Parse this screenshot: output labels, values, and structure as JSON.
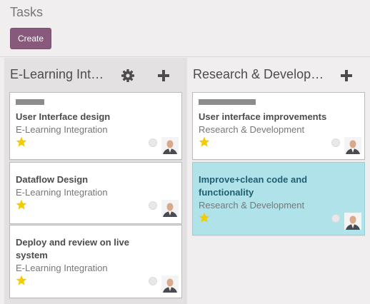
{
  "header": {
    "breadcrumb": "Tasks",
    "create_label": "Create"
  },
  "colors": {
    "primary": "#875a7b",
    "selected_card": "#b0e3e9",
    "star": "#f3cc00",
    "color_bar": "#8c8c8c"
  },
  "columns": [
    {
      "title": "E-Learning Integration",
      "icons": [
        "gear-icon",
        "plus-icon"
      ],
      "cards": [
        {
          "title_lines": [
            "User Interface design"
          ],
          "project": "E-Learning Integration",
          "priority_star": true
        },
        {
          "title_lines": [
            "Dataflow Design"
          ],
          "project": "E-Learning Integration",
          "priority_star": true
        },
        {
          "title_lines": [
            "Deploy and review on live",
            "system"
          ],
          "project": "E-Learning Integration",
          "priority_star": true
        }
      ]
    },
    {
      "title": "Research & Development",
      "icons": [
        "plus-icon"
      ],
      "cards": [
        {
          "title_lines": [
            "User interface improvements"
          ],
          "project": "Research & Development",
          "priority_star": true
        },
        {
          "title_lines": [
            "Improve+clean code and",
            "functionality"
          ],
          "project": "Research & Development",
          "priority_star": true,
          "selected": true
        }
      ]
    }
  ]
}
